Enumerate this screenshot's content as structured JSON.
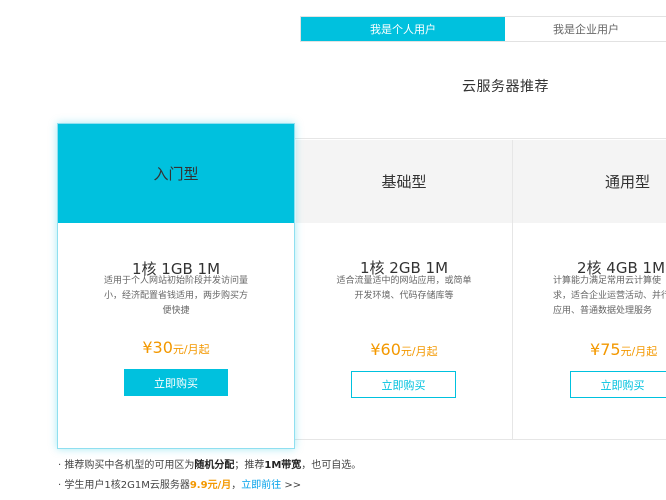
{
  "tabs": {
    "personal": "我是个人用户",
    "enterprise": "我是企业用户"
  },
  "section_title": "云服务器推荐",
  "cards": [
    {
      "name": "入门型",
      "spec": "1核 1GB 1M",
      "desc": "适用于个人网站初始阶段并发访问量小，经济配置省钱适用，两步购买方便快捷",
      "price_symbol": "¥",
      "price": "30",
      "price_unit": "元/月起",
      "buy": "立即购买"
    },
    {
      "name": "基础型",
      "spec": "1核 2GB 1M",
      "desc": "适合流量适中的网站应用，或简单开发环境、代码存储库等",
      "price_symbol": "¥",
      "price": "60",
      "price_unit": "元/月起",
      "buy": "立即购买"
    },
    {
      "name": "通用型",
      "spec": "2核 4GB 1M",
      "desc_lines": [
        "计算能力满足常用云计算使",
        "求，适合企业运营活动、并行",
        "应用、普通数据处理服务"
      ],
      "price_symbol": "¥",
      "price": "75",
      "price_unit": "元/月起",
      "buy": "立即购买"
    }
  ],
  "notes": {
    "line1_prefix": "· 推荐购买中各机型的可用区为",
    "line1_bold1": "随机分配",
    "line1_mid": "；推荐",
    "line1_bold2": "1M带宽",
    "line1_suffix": "，也可自选。",
    "line2_prefix": "· 学生用户1核2G1M云服务器",
    "line2_price": "9.9元/月",
    "line2_sep": "，",
    "line2_link": "立即前往",
    "line2_arrow": " >>"
  },
  "colors": {
    "accent": "#00c1de",
    "price": "#f39800",
    "link": "#00a0e9"
  }
}
